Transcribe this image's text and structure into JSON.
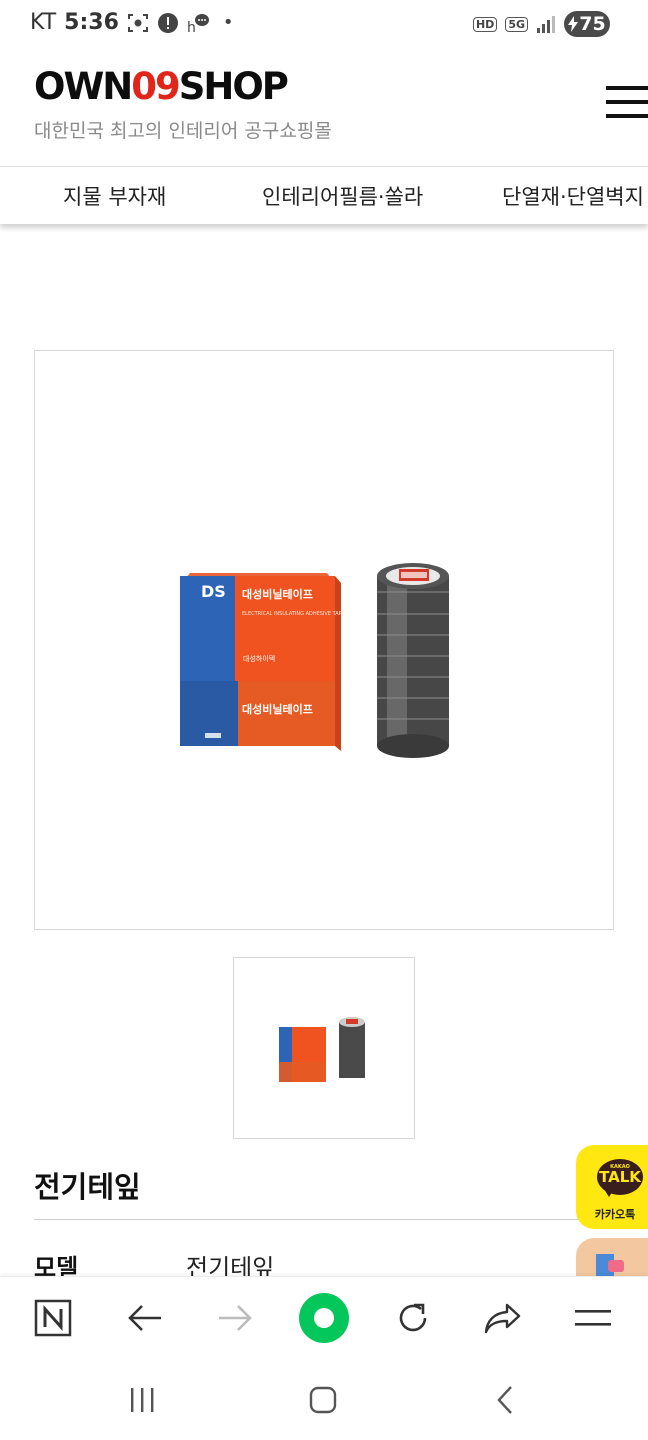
{
  "status_bar": {
    "carrier": "KT",
    "time": "5:36",
    "dot": "•",
    "hd_badge": "HD",
    "network": "5G",
    "battery": "75"
  },
  "header": {
    "logo_own": "OWN",
    "logo_09": "09",
    "logo_shop": "SHOP",
    "tagline": "대한민국 최고의 인테리어 공구쇼핑몰"
  },
  "categories": [
    "지물 부자재",
    "인테리어필름·쏠라",
    "단열재·단열벽지"
  ],
  "product_image": {
    "box_brand": "DS",
    "box_title": "대성비닐테이프",
    "box_subtitle": "ELECTRICAL INSULATING ADHESIVE TAPE",
    "box_maker": "대성하이텍"
  },
  "product": {
    "title": "전기테잎",
    "spec_label": "모델",
    "spec_value": "전기테잎"
  },
  "kakao": {
    "bubble_small": "KAKAO",
    "bubble_text": "TALK",
    "label": "카카오톡"
  },
  "colors": {
    "logo_red": "#e0261b",
    "kakao_yellow": "#ffe812",
    "home_green": "#03c75a"
  },
  "icons": {
    "toolbar": [
      "naver-n-icon",
      "back-arrow-icon",
      "forward-arrow-icon",
      "home-green-icon",
      "refresh-icon",
      "share-icon",
      "menu-icon"
    ],
    "android": [
      "recent-apps-icon",
      "home-icon",
      "back-icon"
    ]
  }
}
